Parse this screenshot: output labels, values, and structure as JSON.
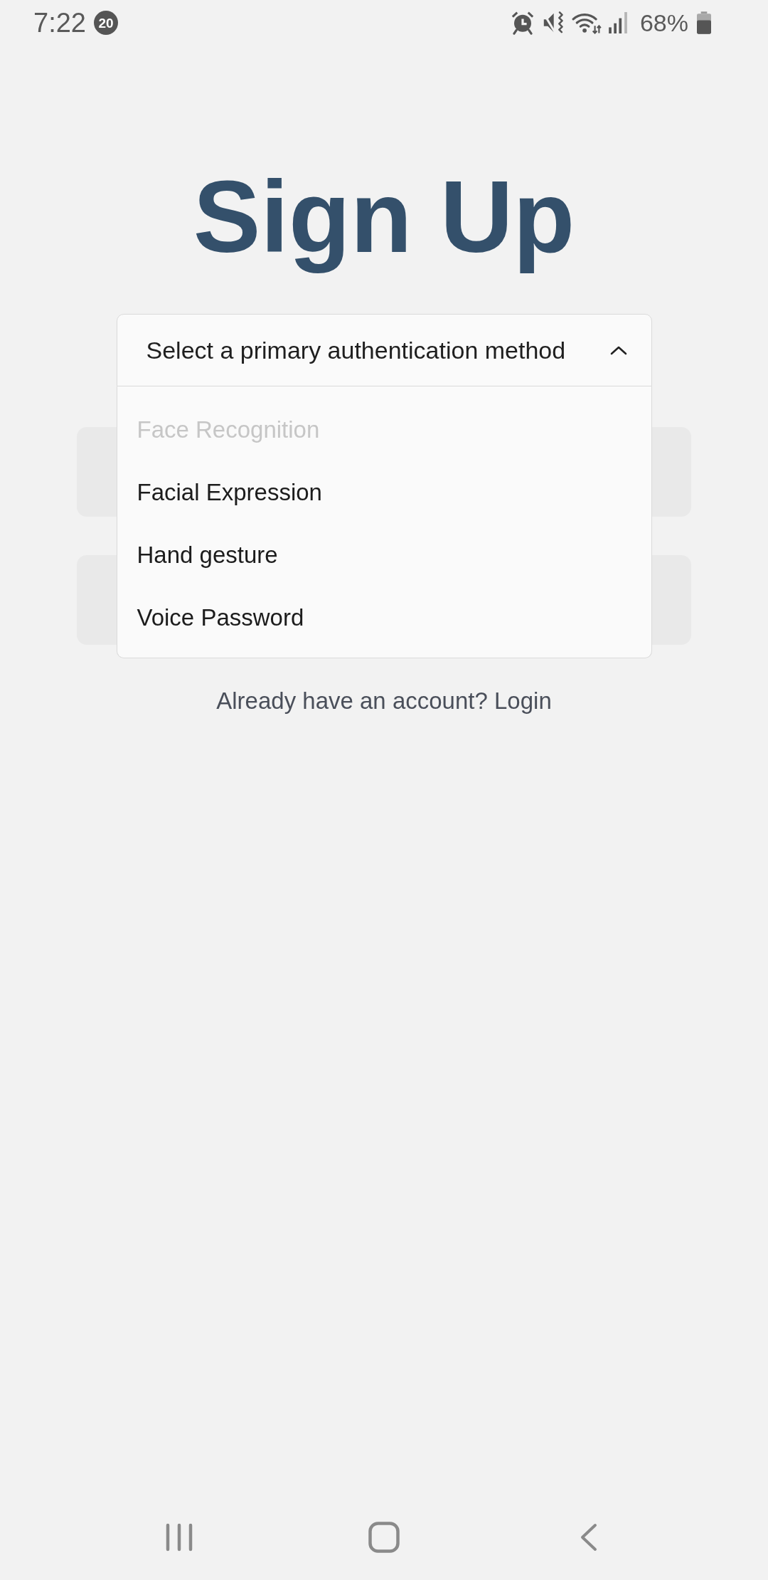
{
  "status_bar": {
    "time": "7:22",
    "notification_count": "20",
    "battery_percent": "68%"
  },
  "title": "Sign Up",
  "auth_method_dropdown": {
    "prompt": "Select a primary authentication method",
    "expanded": true,
    "options": [
      {
        "label": "Face Recognition",
        "disabled": true
      },
      {
        "label": "Facial Expression",
        "disabled": false
      },
      {
        "label": "Hand gesture",
        "disabled": false
      },
      {
        "label": "Voice Password",
        "disabled": false
      }
    ]
  },
  "fields": [
    {
      "kind": "text_input"
    },
    {
      "kind": "text_input"
    }
  ],
  "login_link": "Already have an account? Login"
}
